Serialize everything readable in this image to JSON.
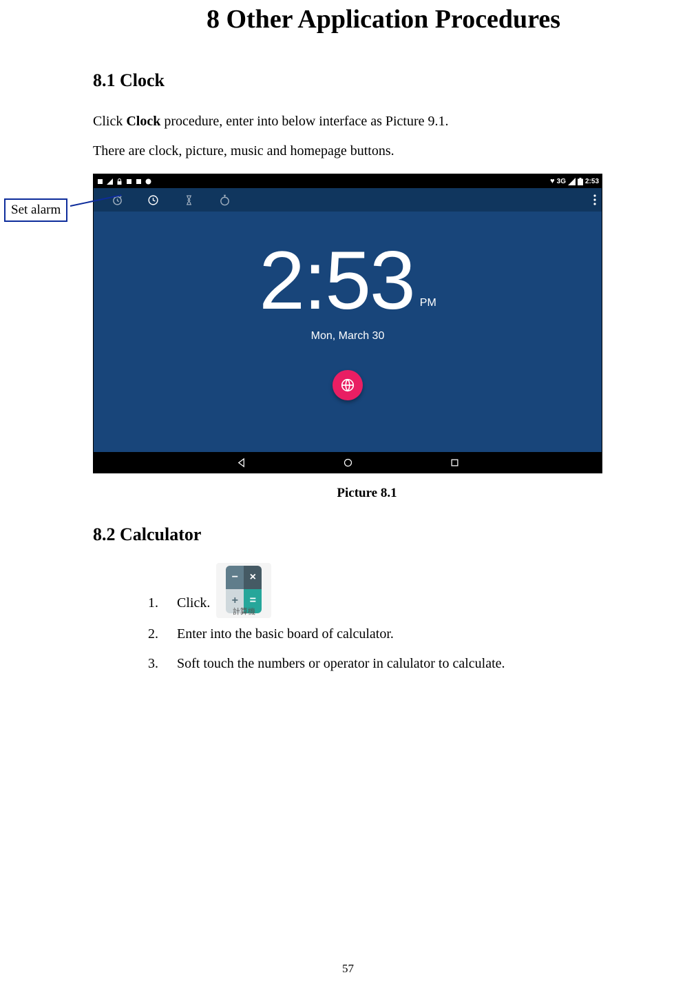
{
  "chapter_title": "8 Other Application Procedures",
  "section_8_1": "8.1 Clock",
  "p1_a": "Click ",
  "p1_b": "Clock",
  "p1_c": " procedure, enter into below interface as Picture 9.1.",
  "p2": "There are clock, picture, music and homepage buttons.",
  "callout": "Set alarm",
  "screenshot": {
    "status_left_icons": [
      "🕑",
      "📶",
      "🔒",
      "📶",
      "🗑",
      "❓"
    ],
    "status_right": {
      "net": "3G",
      "batt": "🔋",
      "time": "2:53",
      "wifi": "▾"
    },
    "time": "2:53",
    "ampm": "PM",
    "date": "Mon, March 30"
  },
  "caption_8_1": "Picture 8.1",
  "section_8_2": "8.2 Calculator",
  "calc_icon_label": "計算機",
  "steps": [
    "Click.",
    "Enter into the basic board of calculator.",
    "Soft touch the numbers or operator in calulator to calculate."
  ],
  "page_number": "57"
}
